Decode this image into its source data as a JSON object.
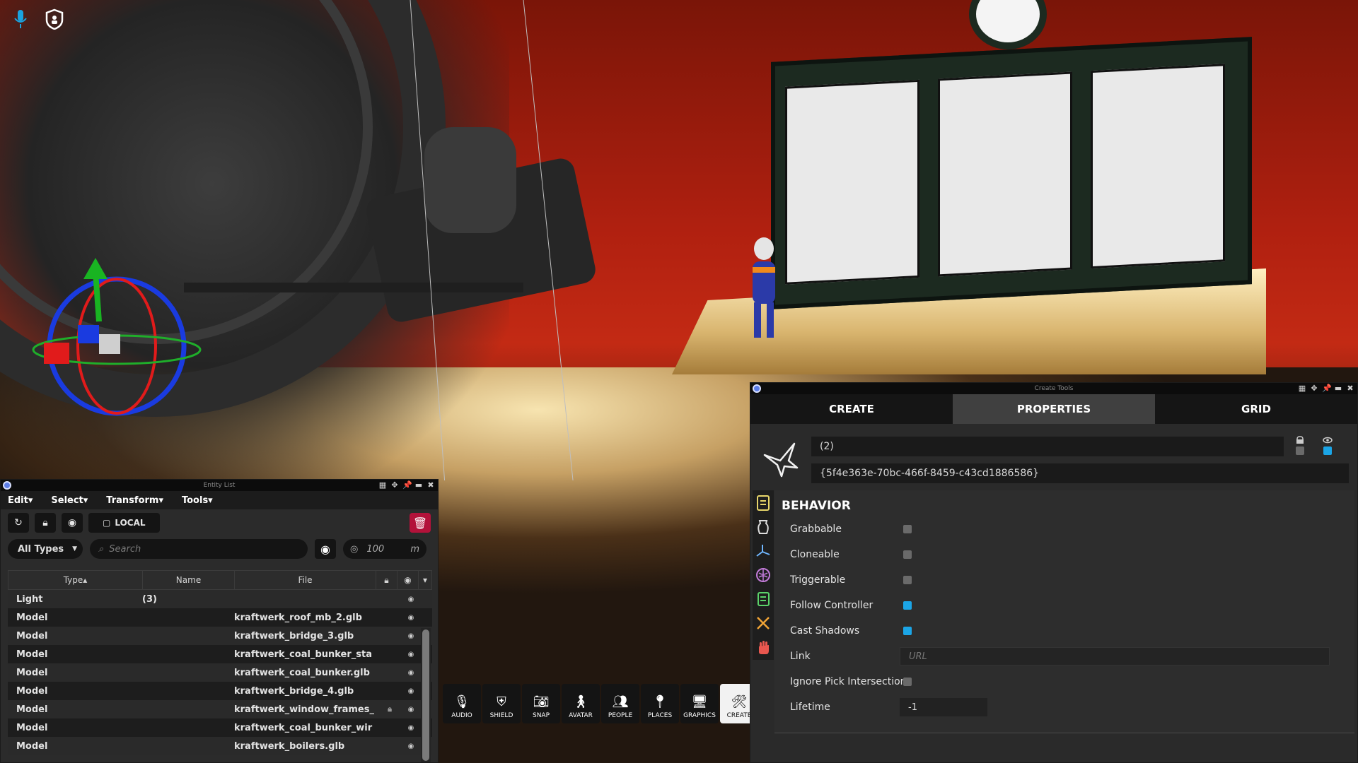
{
  "colors": {
    "accent_checkbox": "#1ba5e6",
    "delete_button": "#b3123a",
    "active_tab": "#404040",
    "window_bg": "#2a2a2a"
  },
  "hud": {
    "icons": [
      "microphone-icon",
      "shield-icon"
    ]
  },
  "entity_list": {
    "title": "Entity List",
    "menu": {
      "edit": "Edit▾",
      "select": "Select▾",
      "transform": "Transform▾",
      "tools": "Tools▾"
    },
    "local_label": "LOCAL",
    "filter": {
      "types": "All Types",
      "search_placeholder": "Search",
      "range_value": "100",
      "range_unit": "m"
    },
    "columns": {
      "type": "Type▴",
      "name": "Name",
      "file": "File"
    },
    "rows": [
      {
        "type": "Light",
        "name": "(3)",
        "file": "",
        "locked": false
      },
      {
        "type": "Model",
        "name": "",
        "file": "kraftwerk_roof_mb_2.glb",
        "locked": false
      },
      {
        "type": "Model",
        "name": "",
        "file": "kraftwerk_bridge_3.glb",
        "locked": false
      },
      {
        "type": "Model",
        "name": "",
        "file": "kraftwerk_coal_bunker_sta",
        "locked": false
      },
      {
        "type": "Model",
        "name": "",
        "file": "kraftwerk_coal_bunker.glb",
        "locked": false
      },
      {
        "type": "Model",
        "name": "",
        "file": "kraftwerk_bridge_4.glb",
        "locked": false
      },
      {
        "type": "Model",
        "name": "",
        "file": "kraftwerk_window_frames_",
        "locked": true
      },
      {
        "type": "Model",
        "name": "",
        "file": "kraftwerk_coal_bunker_wir",
        "locked": false
      },
      {
        "type": "Model",
        "name": "",
        "file": "kraftwerk_boilers.glb",
        "locked": false
      }
    ]
  },
  "toolbar": {
    "buttons": [
      {
        "label": "AUDIO",
        "icon": "microphone-icon"
      },
      {
        "label": "SHIELD",
        "icon": "shield-icon"
      },
      {
        "label": "SNAP",
        "icon": "camera-icon"
      },
      {
        "label": "AVATAR",
        "icon": "person-icon"
      },
      {
        "label": "PEOPLE",
        "icon": "people-icon"
      },
      {
        "label": "PLACES",
        "icon": "map-pin-icon"
      },
      {
        "label": "GRAPHICS",
        "icon": "monitor-gear-icon"
      },
      {
        "label": "CREATE",
        "icon": "tools-icon",
        "active": true
      }
    ]
  },
  "create_tools": {
    "title": "Create Tools",
    "tabs": [
      "CREATE",
      "PROPERTIES",
      "GRID"
    ],
    "active_tab": "PROPERTIES",
    "entity_name": "(2)",
    "entity_id": "{5f4e363e-70bc-466f-8459-c43cd1886586}",
    "section": "BEHAVIOR",
    "properties": {
      "grabbable": {
        "label": "Grabbable",
        "checked": false
      },
      "cloneable": {
        "label": "Cloneable",
        "checked": false
      },
      "triggerable": {
        "label": "Triggerable",
        "checked": false
      },
      "follow_controller": {
        "label": "Follow Controller",
        "checked": true
      },
      "cast_shadows": {
        "label": "Cast Shadows",
        "checked": true
      },
      "link": {
        "label": "Link",
        "placeholder": "URL"
      },
      "ignore_pick": {
        "label": "Ignore Pick Intersection",
        "checked": false
      },
      "lifetime": {
        "label": "Lifetime",
        "value": "-1"
      }
    }
  }
}
